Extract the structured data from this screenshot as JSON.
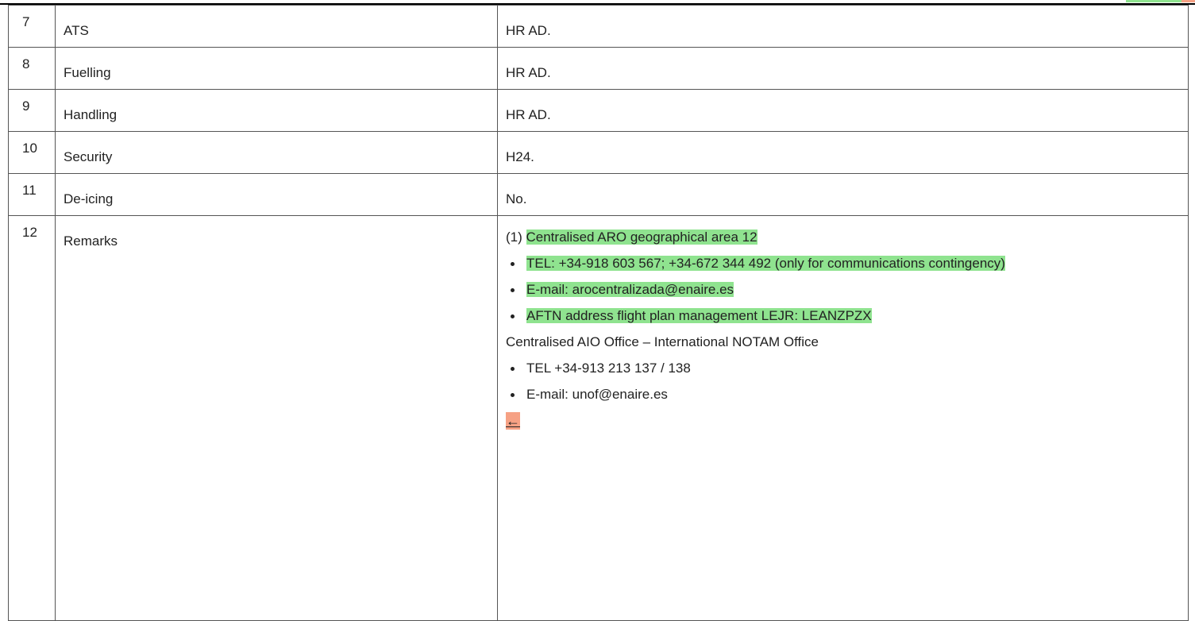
{
  "rows": [
    {
      "num": "7",
      "item": "ATS",
      "value": "HR AD."
    },
    {
      "num": "8",
      "item": "Fuelling",
      "value": "HR AD."
    },
    {
      "num": "9",
      "item": "Handling",
      "value": "HR AD."
    },
    {
      "num": "10",
      "item": "Security",
      "value": "H24."
    },
    {
      "num": "11",
      "item": "De-icing",
      "value": "No."
    }
  ],
  "remarks_row": {
    "num": "12",
    "item": "Remarks",
    "aro_prefix": "(1) ",
    "aro_title": "Centralised ARO geographical area 12",
    "aro_tel": "TEL: +34-918 603 567; +34-672 344 492 (only for communications contingency)",
    "aro_email": "E-mail: arocentralizada@enaire.es",
    "aro_aftn": "AFTN address flight plan management LEJR: LEANZPZX",
    "aio_title": "Centralised AIO Office – International NOTAM Office",
    "aio_tel": "TEL +34-913 213 137 / 138",
    "aio_email": "E-mail: unof@enaire.es",
    "deleted_mark": "←"
  },
  "colors": {
    "inserted_highlight": "#8fe38f",
    "deleted_highlight": "#f6a184"
  }
}
